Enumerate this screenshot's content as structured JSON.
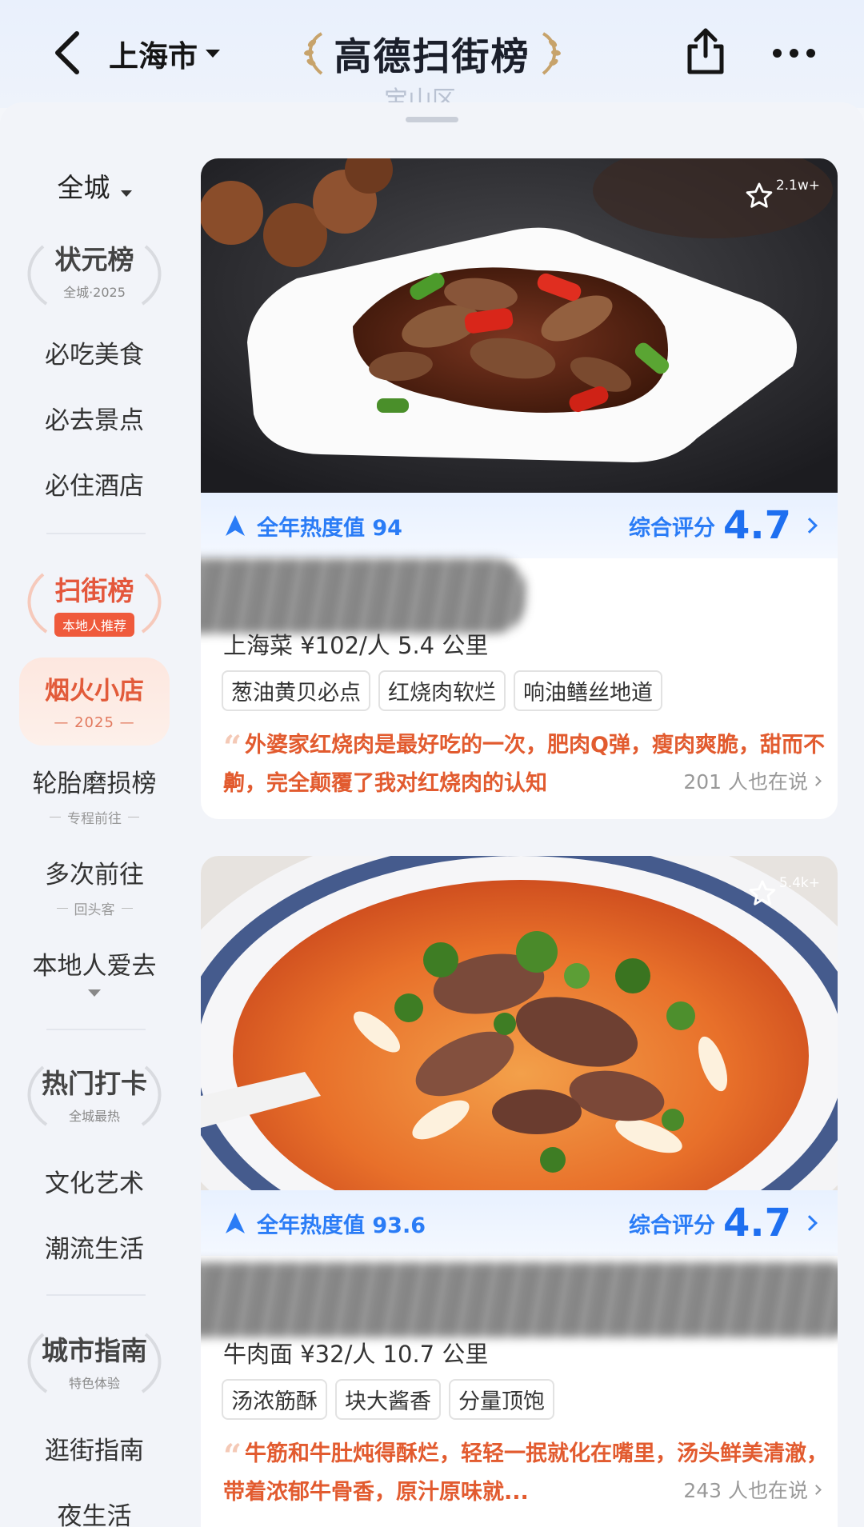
{
  "header": {
    "city": "上海市",
    "brand_title": "高德扫街榜",
    "ghost_district": "宝山区"
  },
  "sidenav": {
    "scope": "全城",
    "zhuangyuan": {
      "title": "状元榜",
      "sub": "全城·2025"
    },
    "items_group1": [
      "必吃美食",
      "必去景点",
      "必住酒店"
    ],
    "saojie": {
      "title": "扫街榜",
      "pill": "本地人推荐"
    },
    "yanhuo": {
      "title": "烟火小店",
      "sub": "— 2025 —"
    },
    "luntai": {
      "title": "轮胎磨损榜",
      "sub": "专程前往"
    },
    "duoci": {
      "title": "多次前往",
      "sub": "回头客"
    },
    "bendi": {
      "title": "本地人爱去"
    },
    "remen": {
      "title": "热门打卡",
      "sub": "全城最热"
    },
    "items_group2": [
      "文化艺术",
      "潮流生活"
    ],
    "chengshi": {
      "title": "城市指南",
      "sub": "特色体验"
    },
    "items_group3": [
      "逛街指南",
      "夜生活"
    ]
  },
  "cards": [
    {
      "fav_count": "2.1w+",
      "heat": "全年热度值 94",
      "score_label": "综合评分",
      "score": "4.7",
      "meta": "上海菜 ¥102/人 5.4 公里",
      "tags": [
        "葱油黄贝必点",
        "红烧肉软烂",
        "响油鳝丝地道"
      ],
      "quote": "外婆家红烧肉是最好吃的一次，肥肉Q弹，瘦肉爽脆，甜而不齁，完全颠覆了我对红烧肉的认知",
      "talk": "201 人也在说"
    },
    {
      "fav_count": "5.4k+",
      "heat": "全年热度值 93.6",
      "score_label": "综合评分",
      "score": "4.7",
      "meta": "牛肉面 ¥32/人 10.7 公里",
      "tags": [
        "汤浓筋酥",
        "块大酱香",
        "分量顶饱"
      ],
      "quote": "牛筋和牛肚炖得酥烂，轻轻一抿就化在嘴里，汤头鲜美清澈，带着浓郁牛骨香，原汁原味就...",
      "talk": "243 人也在说"
    }
  ],
  "colors": {
    "accent_blue": "#2a7cf6",
    "accent_red": "#e25b3a",
    "quote_orange": "#e25b2f"
  }
}
